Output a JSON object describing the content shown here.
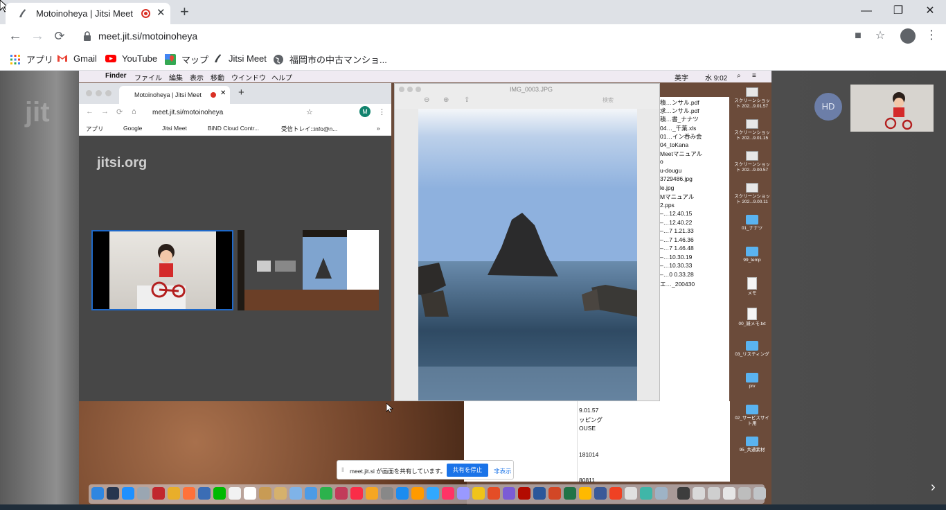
{
  "browser": {
    "tab_title": "Motoinoheya | Jitsi Meet",
    "tab_close": "✕",
    "new_tab": "+",
    "window_controls": {
      "minimize": "—",
      "restore": "❐",
      "close": "✕"
    },
    "url": "meet.jit.si/motoinoheya",
    "bookmarks": [
      {
        "label": "アプリ",
        "icon": "apps-grid-icon"
      },
      {
        "label": "Gmail",
        "icon": "gmail-icon"
      },
      {
        "label": "YouTube",
        "icon": "youtube-icon"
      },
      {
        "label": "マップ",
        "icon": "maps-icon"
      },
      {
        "label": "Jitsi Meet",
        "icon": "jitsi-icon"
      },
      {
        "label": "福岡市の中古マンショ...",
        "icon": "globe-icon"
      }
    ]
  },
  "jitsi": {
    "watermark": "jit",
    "participant_initials": "HD",
    "next_arrow": "›"
  },
  "mac": {
    "menu": [
      "Finder",
      "ファイル",
      "編集",
      "表示",
      "移動",
      "ウインドウ",
      "ヘルプ"
    ],
    "clock": "水 9:02",
    "input_mode": "英字"
  },
  "inner_chrome": {
    "tab_title": "Motoinoheya | Jitsi Meet",
    "url": "meet.jit.si/motoinoheya",
    "avatar": "M",
    "bookmarks": [
      "アプリ",
      "Google",
      "Jitsi Meet",
      "BiND Cloud Contr...",
      "受信トレイ::info@n...",
      "»"
    ],
    "logo": "jitsi.org"
  },
  "preview": {
    "filename": "IMG_0003.JPG",
    "search_placeholder": "検索"
  },
  "finder": {
    "items": [
      "積…ンサル.pdf",
      "求…ンサル.pdf",
      "積…書_ナナツ",
      "04…_千葉.xls",
      "01…イン呑み会",
      "04_toKana",
      "Meetマニュアル",
      "o",
      "u-dougu",
      "3729486.jpg",
      "le.jpg",
      "Mマニュアル",
      "2.pps",
      "–…12.40.15",
      "–…12.40.22",
      "–…7 1.21.33",
      "–…7 1.46.36",
      "–…7 1.46.48",
      "–…10.30.19",
      "–…10.30.33",
      "–…0 0.33.28",
      "エ…_200430"
    ],
    "lower_items": [
      "9.01.57",
      "ッピング",
      "OUSE",
      "181014",
      "80811"
    ]
  },
  "desktop_icons": [
    {
      "label": "スクリーンショット 202...9.01.57",
      "kind": "thumb"
    },
    {
      "label": "スクリーンショット 202...9.01.15",
      "kind": "thumb"
    },
    {
      "label": "スクリーンショット 202...9.00.57",
      "kind": "thumb"
    },
    {
      "label": "スクリーンショット 202...9.00.11",
      "kind": "thumb"
    },
    {
      "label": "01_ナナツ",
      "kind": "folder"
    },
    {
      "label": "99_temp",
      "kind": "folder"
    },
    {
      "label": "メモ",
      "kind": "doc"
    },
    {
      "label": "00_雑メモ.txt",
      "kind": "doc"
    },
    {
      "label": "03_リスティング",
      "kind": "folder"
    },
    {
      "label": "prv",
      "kind": "folder"
    },
    {
      "label": "02_サービスサイト用",
      "kind": "folder"
    },
    {
      "label": "95_共通素材",
      "kind": "folder"
    }
  ],
  "share_banner": {
    "text": "meet.jit.si が画面を共有しています。",
    "stop_label": "共有を停止",
    "hide_label": "非表示"
  },
  "colors": {
    "accent_blue": "#1a73e8",
    "record_red": "#d93025",
    "jitsi_stage": "#474747",
    "selected_video_border": "#1e68c8"
  }
}
